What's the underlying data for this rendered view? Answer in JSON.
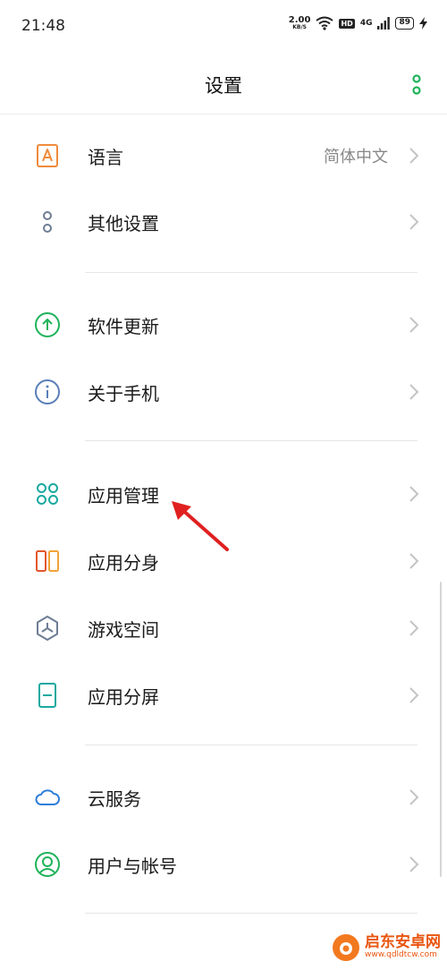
{
  "status_bar": {
    "time": "21:48",
    "net_speed": "2.00",
    "net_unit": "KB/S",
    "hd": "HD",
    "signal": "4G",
    "battery": "89"
  },
  "header": {
    "title": "设置"
  },
  "items": [
    {
      "label": "语言",
      "value": "简体中文",
      "icon": "language-icon"
    },
    {
      "label": "其他设置",
      "icon": "other-settings-icon"
    },
    {
      "label": "软件更新",
      "icon": "software-update-icon"
    },
    {
      "label": "关于手机",
      "icon": "about-phone-icon"
    },
    {
      "label": "应用管理",
      "icon": "app-management-icon"
    },
    {
      "label": "应用分身",
      "icon": "app-clone-icon"
    },
    {
      "label": "游戏空间",
      "icon": "game-space-icon"
    },
    {
      "label": "应用分屏",
      "icon": "split-screen-icon"
    },
    {
      "label": "云服务",
      "icon": "cloud-service-icon"
    },
    {
      "label": "用户与帐号",
      "icon": "user-account-icon"
    }
  ],
  "watermark": {
    "name": "启东安卓网",
    "url": "www.qdldtcw.com"
  },
  "colors": {
    "accent_green": "#1fb35a",
    "arrow_red": "#e02020",
    "chevron": "#c4c4c4"
  }
}
